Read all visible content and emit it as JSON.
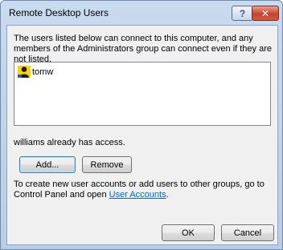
{
  "window": {
    "title": "Remote Desktop Users",
    "help_label": "?",
    "close_label": "✕"
  },
  "description": "The users listed below can connect to this computer, and any members of the Administrators group can connect even if they are not listed.",
  "users": [
    {
      "name": "tomw"
    }
  ],
  "access_text": "williams already has access.",
  "buttons": {
    "add": "Add...",
    "remove": "Remove",
    "ok": "OK",
    "cancel": "Cancel"
  },
  "info": {
    "prefix": "To create new user accounts or add users to other groups, go to Control Panel and open ",
    "link": "User Accounts",
    "suffix": "."
  }
}
